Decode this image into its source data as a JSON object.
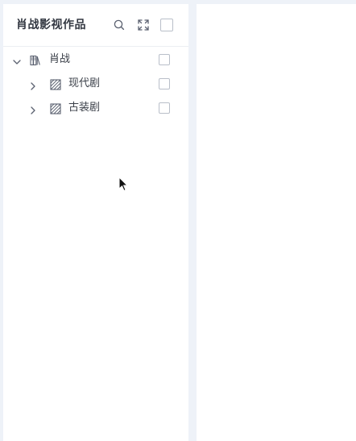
{
  "panel": {
    "title": "肖战影视作品"
  },
  "tree": {
    "root": {
      "label": "肖战",
      "expanded": true
    },
    "children": [
      {
        "label": "现代剧",
        "expanded": false
      },
      {
        "label": "古装剧",
        "expanded": false
      }
    ]
  },
  "icons": {
    "search": "search-icon",
    "fullscreen": "fullscreen-icon",
    "root_node": "library-icon",
    "child_node": "category-icon"
  },
  "colors": {
    "background": "#eef2f8",
    "panel": "#ffffff",
    "text": "#333842",
    "border": "#b9bfc9"
  }
}
